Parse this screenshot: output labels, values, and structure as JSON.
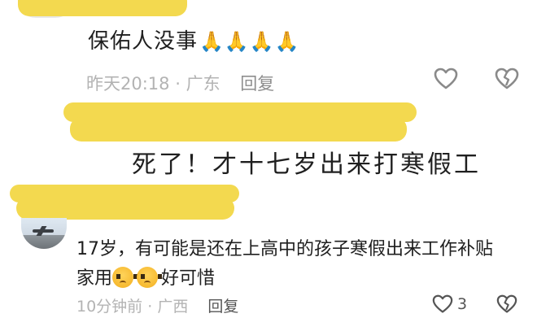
{
  "comment1": {
    "text": "保佑人没事",
    "emojis": "🙏🙏🙏🙏",
    "time": "昨天20:18",
    "separator": "·",
    "location": "广东",
    "reply": "回复"
  },
  "comment2": {
    "text": "死了！才十七岁出来打寒假工"
  },
  "comment3": {
    "line1": "17岁，有可能是还在上高中的孩子寒假出来工作补贴",
    "line2_prefix": "家用",
    "line2_suffix": "好可惜",
    "time": "10分钟前",
    "separator": "·",
    "location": "广西",
    "reply": "回复",
    "like_count": "3"
  },
  "icons": {
    "like": "heart-outline-icon",
    "dislike": "broken-heart-icon",
    "emoji": "crying-face-emoji"
  },
  "colors": {
    "redaction": "#f3d94f",
    "meta_text": "#b3b3b3",
    "reply_text": "#8e8e8e"
  }
}
